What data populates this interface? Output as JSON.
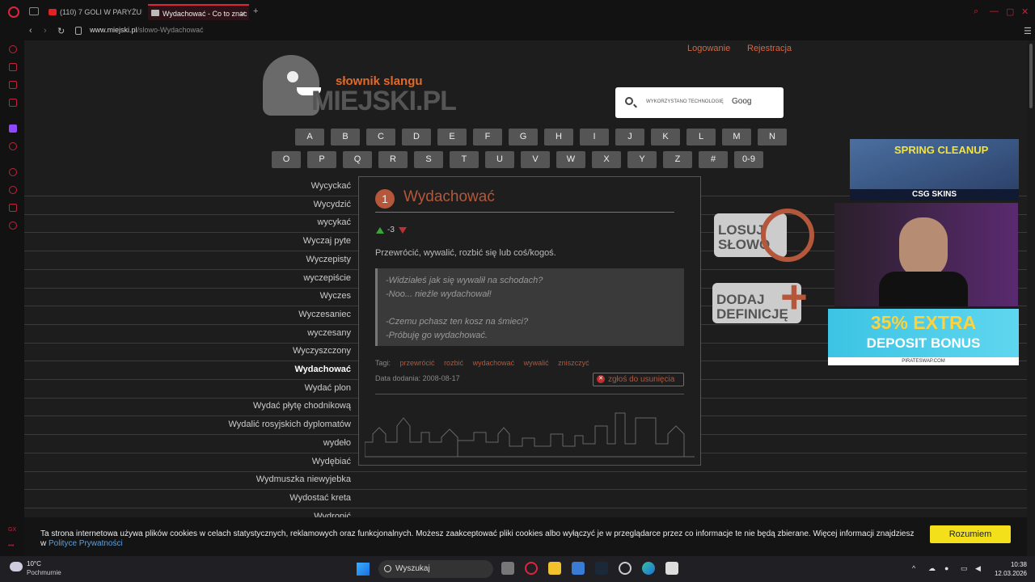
{
  "browser": {
    "tabs": [
      {
        "label": "(110) 7 GOLI W PARYŻU! P"
      },
      {
        "label": "Wydachować - Co to znac"
      }
    ],
    "new_tab": "+",
    "address": {
      "host": "www.miejski.pl",
      "path": "/slowo-Wydachować"
    }
  },
  "header": {
    "login": "Logowanie",
    "register": "Rejestracja",
    "logo_top": "słownik slangu",
    "logo_main": "MIEJSKI.PL",
    "search_powered": "WYKORZYSTANO TECHNOLOGIĘ",
    "search_brand": "Goog"
  },
  "letters_row1": [
    "A",
    "B",
    "C",
    "D",
    "E",
    "F",
    "G",
    "H",
    "I",
    "J",
    "K",
    "L",
    "M",
    "N"
  ],
  "letters_row2": [
    "O",
    "P",
    "Q",
    "R",
    "S",
    "T",
    "U",
    "V",
    "W",
    "X",
    "Y",
    "Z",
    "#",
    "0-9"
  ],
  "words": [
    "Wycyckać",
    "Wycydzić",
    "wycykać",
    "Wyczaj pyte",
    "Wyczepisty",
    "wyczepiście",
    "Wyczes",
    "Wyczesaniec",
    "wyczesany",
    "Wyczyszczony",
    "Wydachować",
    "Wydać plon",
    "Wydać płytę chodnikową",
    "Wydalić rosyjskich dyplomatów",
    "wydeło",
    "Wydębiać",
    "Wydmuszka niewyjebka",
    "Wydostać kreta",
    "Wydropić"
  ],
  "selected_word": "Wydachować",
  "definition": {
    "number": "1",
    "title": "Wydachować",
    "score": "-3",
    "text": "Przewrócić, wywalić, rozbić się lub coś/kogoś.",
    "example_lines": [
      "-Widziałeś jak się wywalił na schodach?",
      "-Noo... nieźle wydachował!",
      "",
      "-Czemu pchasz ten kosz na śmieci?",
      "-Próbuję go wydachować."
    ],
    "tags_label": "Tagi:",
    "tags": [
      "przewrócić",
      "rozbić",
      "wydachować",
      "wywalić",
      "zniszczyć"
    ],
    "date_label": "Data dodania:",
    "date": "2008-08-17",
    "report": "zgłoś do usunięcia"
  },
  "side_buttons": {
    "losuj": [
      "LOSUJ",
      "SŁOWO"
    ],
    "dodaj": [
      "DODAJ",
      "DEFINICJĘ"
    ]
  },
  "ads": {
    "ad1_title": "SPRING CLEANUP",
    "ad1_brand": "CSG SKINS",
    "ad3_line1": "35% EXTRA",
    "ad3_line2": "DEPOSIT BONUS",
    "ad3_site": "PIRATESWAP.COM"
  },
  "cookie": {
    "text": "Ta strona internetowa używa plików cookies w celach statystycznych, reklamowych oraz funkcjonalnych. Możesz zaakceptować pliki cookies albo wyłączyć je w przeglądarce przez co informacje te nie będą zbierane. Więcej informacji znajdziesz w ",
    "link": "Polityce Prywatności",
    "accept": "Rozumiem"
  },
  "taskbar": {
    "temp": "10°C",
    "weather": "Pochmurnie",
    "search": "Wyszukaj",
    "time": "10:38",
    "date": "12.03.2026"
  },
  "sidebar_label": "GX",
  "colors": {
    "accent": "#b4573a",
    "brand": "#e0243b",
    "cookie_button": "#f3e01a"
  }
}
